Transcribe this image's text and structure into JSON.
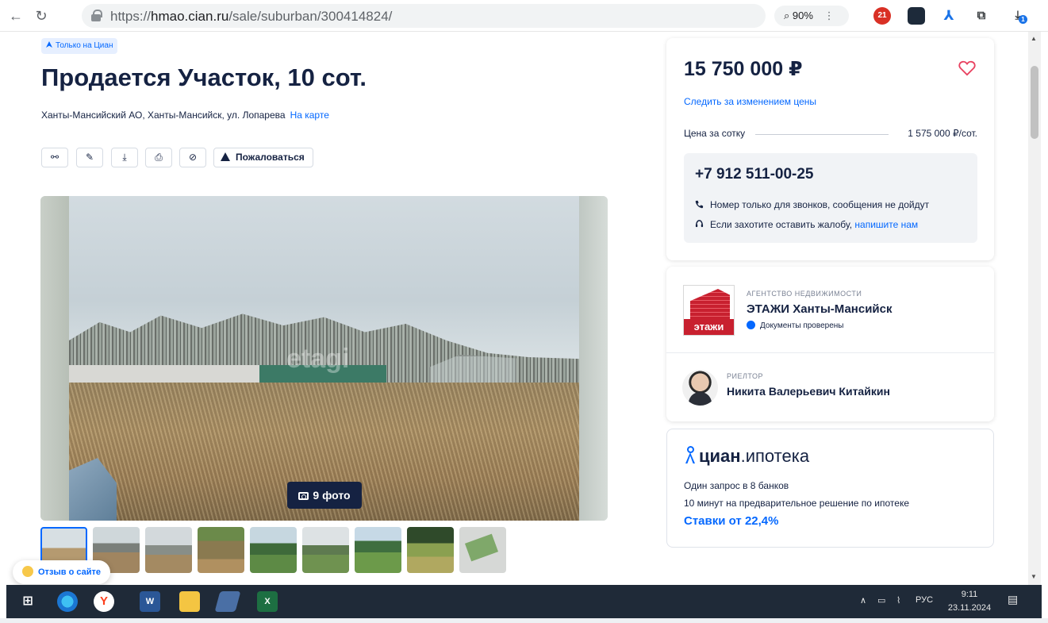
{
  "browser": {
    "url_prefix": "https://",
    "url_host": "hmao.cian.ru",
    "url_path": "/sale/suburban/300414824/",
    "zoom": "90%",
    "ext_badge_count": "21",
    "download_badge": "1"
  },
  "listing": {
    "badge": "Только на Циан",
    "title": "Продается Участок, 10 сот.",
    "address": "Ханты-Мансийский АО, Ханты-Мансийск, ул. Лопарева",
    "map_link": "На карте",
    "report_button": "Пожаловаться",
    "photo_watermark": "etagi",
    "photo_count_label": "9 фото"
  },
  "price_card": {
    "price": "15 750 000 ₽",
    "track_link": "Следить за изменением цены",
    "per_unit_label": "Цена за сотку",
    "per_unit_value": "1 575 000 ₽/сот.",
    "phone": "+7 912 511-00-25",
    "calls_only": "Номер только для звонков, сообщения не дойдут",
    "complaint_text": "Если захотите оставить жалобу,",
    "complaint_link": "напишите нам"
  },
  "agency_card": {
    "agency_caption": "АГЕНТСТВО НЕДВИЖИМОСТИ",
    "agency_logo_text": "этажи",
    "agency_name": "ЭТАЖИ Ханты-Мансийск",
    "verified": "Документы проверены",
    "agent_caption": "РИЕЛТОР",
    "agent_name": "Никита Валерьевич Китайкин"
  },
  "mortgage_card": {
    "brand_bold": "циан",
    "brand_rest": ".ипотека",
    "line1": "Один запрос в 8 банков",
    "line2": "10 минут на предварительное решение по ипотеке",
    "rate": "Ставки от 22,4%"
  },
  "feedback": {
    "label": "Отзыв о сайте"
  },
  "taskbar": {
    "lang": "РУС",
    "time": "9:11",
    "date": "23.11.2024"
  },
  "colors": {
    "accent": "#0468ff",
    "text": "#152242",
    "price_bg": "#f1f3f6",
    "favorite": "#e84260"
  }
}
